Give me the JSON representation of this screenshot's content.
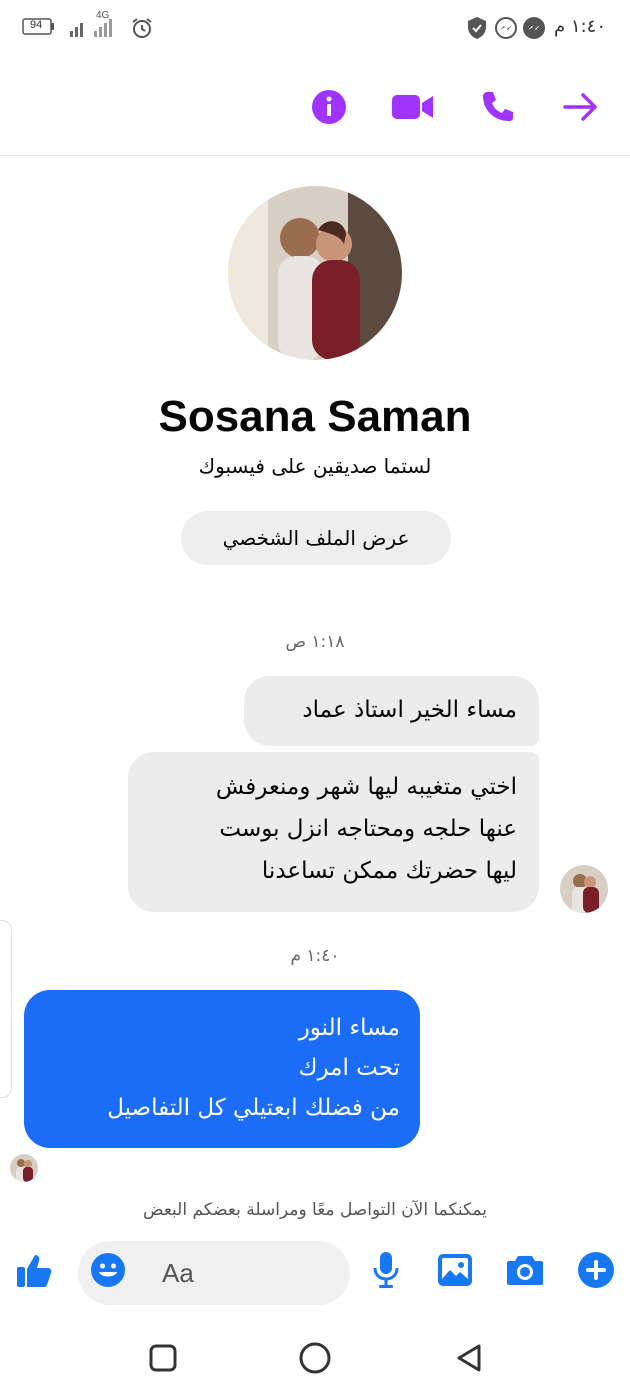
{
  "status_bar": {
    "time": "١:٤٠ م",
    "battery": "94",
    "network": "4G"
  },
  "header": {
    "icons": [
      "back-arrow-icon",
      "phone-icon",
      "video-icon",
      "info-icon"
    ],
    "accent_color": "#a033ff"
  },
  "profile": {
    "name": "Sosana Saman",
    "subtitle": "لستما صديقين على فيسبوك",
    "view_profile_label": "عرض الملف الشخصي"
  },
  "messages": {
    "timestamp_1": "١:١٨ ص",
    "incoming_1": "مساء الخير استاذ عماد",
    "incoming_2_lines": [
      "اختي متغيبه ليها شهر ومنعرفش",
      "عنها حلجه ومحتاجه انزل بوست",
      "ليها حضرتك ممكن تساعدنا"
    ],
    "timestamp_2": "١:٤٠ م",
    "outgoing_1_lines": [
      "مساء النور",
      "تحت امرك",
      "من فضلك ابعتيلي كل التفاصيل"
    ],
    "incoming_color": "#ececec",
    "outgoing_color": "#1b6cf7"
  },
  "notice": "يمكنكما الآن التواصل معًا ومراسلة بعضكم البعض",
  "composer": {
    "placeholder": "Aa",
    "icons": [
      "like-icon",
      "emoji-icon",
      "microphone-icon",
      "gallery-icon",
      "camera-icon",
      "plus-icon"
    ],
    "accent_color": "#1877f2"
  },
  "nav": {
    "icons": [
      "recents-square-icon",
      "home-circle-icon",
      "back-triangle-icon"
    ]
  }
}
